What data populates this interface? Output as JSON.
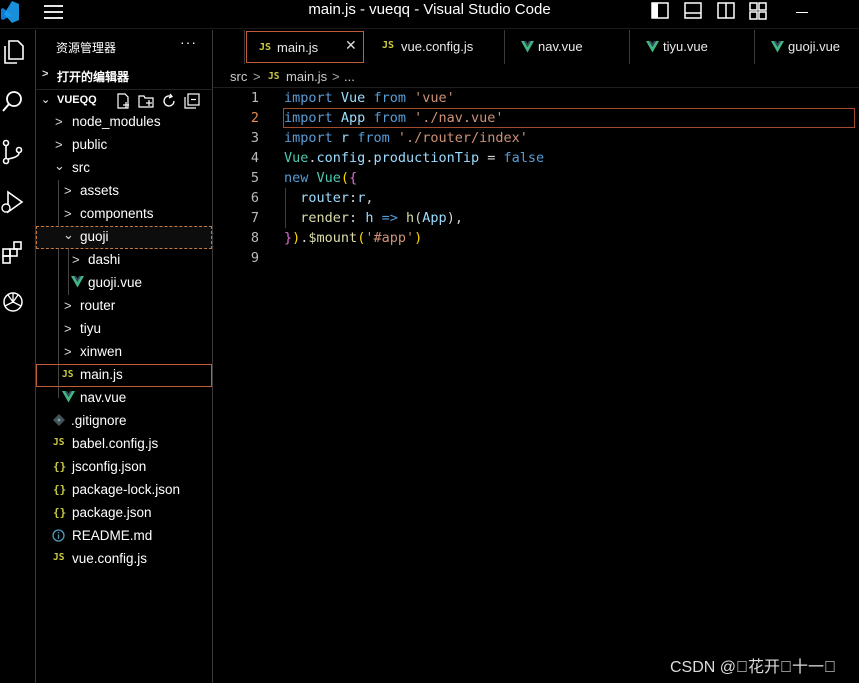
{
  "window": {
    "title": "main.js - vueqq - Visual Studio Code"
  },
  "sidebar": {
    "header": "资源管理器",
    "more": "···",
    "open_editors": "打开的编辑器",
    "project": "VUEQQ",
    "tree": [
      {
        "label": "node_modules",
        "kind": "folder",
        "expanded": false
      },
      {
        "label": "public",
        "kind": "folder",
        "expanded": false
      },
      {
        "label": "src",
        "kind": "folder",
        "expanded": true
      },
      {
        "label": "assets",
        "kind": "folder",
        "expanded": false
      },
      {
        "label": "components",
        "kind": "folder",
        "expanded": false
      },
      {
        "label": "guoji",
        "kind": "folder",
        "expanded": true
      },
      {
        "label": "dashi",
        "kind": "folder",
        "expanded": false
      },
      {
        "label": "guoji.vue",
        "kind": "vue"
      },
      {
        "label": "router",
        "kind": "folder",
        "expanded": false
      },
      {
        "label": "tiyu",
        "kind": "folder",
        "expanded": false
      },
      {
        "label": "xinwen",
        "kind": "folder",
        "expanded": false
      },
      {
        "label": "main.js",
        "kind": "js"
      },
      {
        "label": "nav.vue",
        "kind": "vue"
      },
      {
        "label": ".gitignore",
        "kind": "git"
      },
      {
        "label": "babel.config.js",
        "kind": "js"
      },
      {
        "label": "jsconfig.json",
        "kind": "json"
      },
      {
        "label": "package-lock.json",
        "kind": "json"
      },
      {
        "label": "package.json",
        "kind": "json"
      },
      {
        "label": "README.md",
        "kind": "info"
      },
      {
        "label": "vue.config.js",
        "kind": "js"
      }
    ]
  },
  "tabs": [
    {
      "label": "main.js",
      "icon": "JS",
      "active": true,
      "close": "✕"
    },
    {
      "label": "vue.config.js",
      "icon": "JS",
      "active": false
    },
    {
      "label": "nav.vue",
      "icon": "V",
      "active": false
    },
    {
      "label": "tiyu.vue",
      "icon": "V",
      "active": false
    },
    {
      "label": "guoji.vue",
      "icon": "V",
      "active": false
    }
  ],
  "breadcrumb": {
    "folder": "src",
    "file": "main.js",
    "rest": "..."
  },
  "editor": {
    "current_line": 2,
    "lines": [
      {
        "n": "1",
        "text": "import Vue from 'vue'"
      },
      {
        "n": "2",
        "text": "import App from './nav.vue'"
      },
      {
        "n": "3",
        "text": "import r from './router/index'"
      },
      {
        "n": "4",
        "text": "Vue.config.productionTip = false"
      },
      {
        "n": "5",
        "text": "new Vue({"
      },
      {
        "n": "6",
        "text": "  router:r,"
      },
      {
        "n": "7",
        "text": "  render: h => h(App),"
      },
      {
        "n": "8",
        "text": "}).$mount('#app')"
      },
      {
        "n": "9",
        "text": ""
      }
    ]
  },
  "watermark": "CSDN @\u0000花开\u0000十一\u0000",
  "colors": {
    "accent_border": "#c25b3a",
    "vue_green": "#41b883",
    "js_yellow": "#cbcb41",
    "json_yellow": "#cbcb41"
  }
}
